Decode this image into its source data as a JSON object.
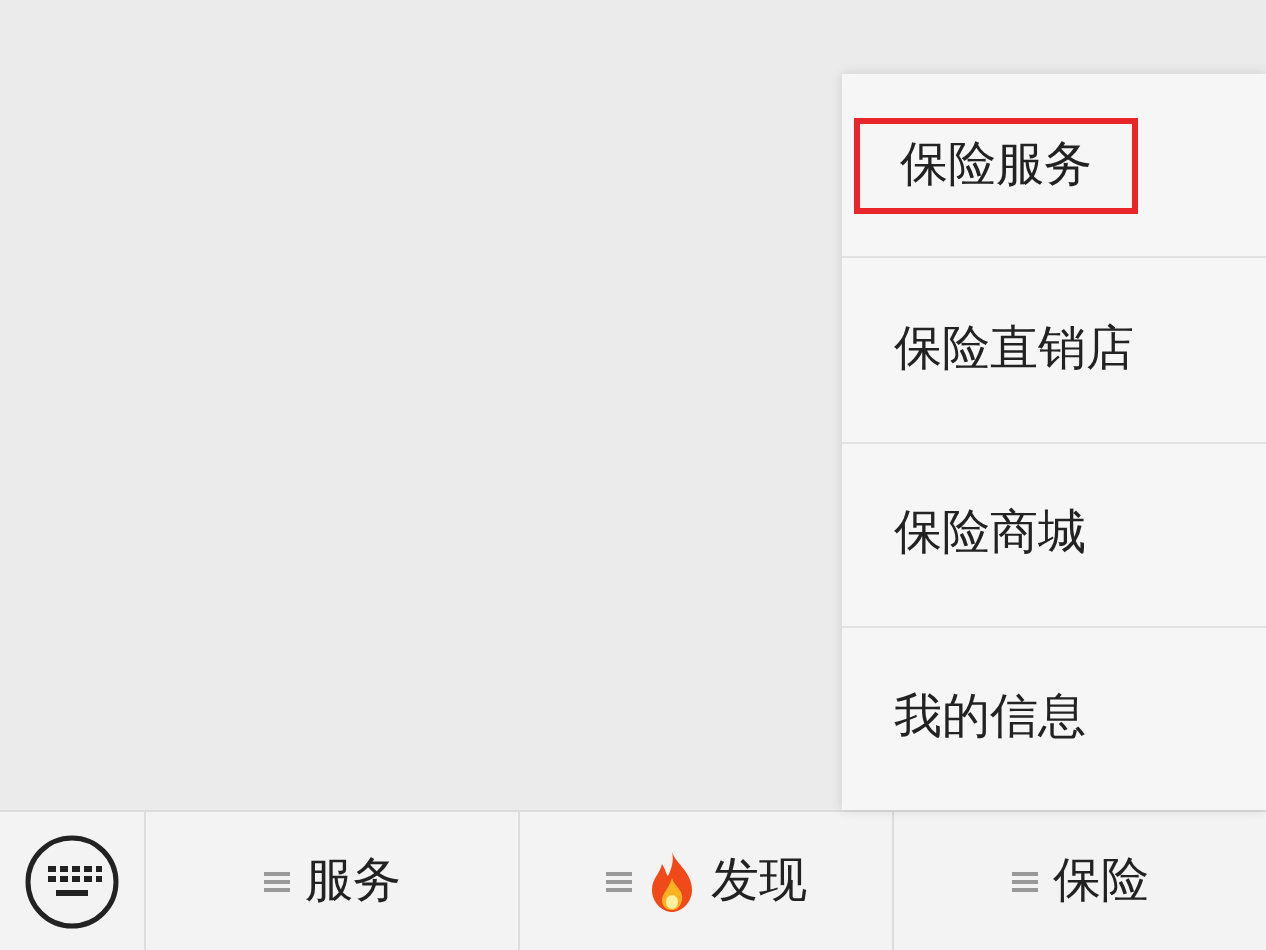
{
  "popup_menu": {
    "items": [
      {
        "label": "保险服务",
        "highlighted": true
      },
      {
        "label": "保险直销店",
        "highlighted": false
      },
      {
        "label": "保险商城",
        "highlighted": false
      },
      {
        "label": "我的信息",
        "highlighted": false
      }
    ]
  },
  "bottom_menu": {
    "tabs": [
      {
        "label": "服务",
        "flame": false
      },
      {
        "label": "发现",
        "flame": true
      },
      {
        "label": "保险",
        "flame": false
      }
    ]
  }
}
